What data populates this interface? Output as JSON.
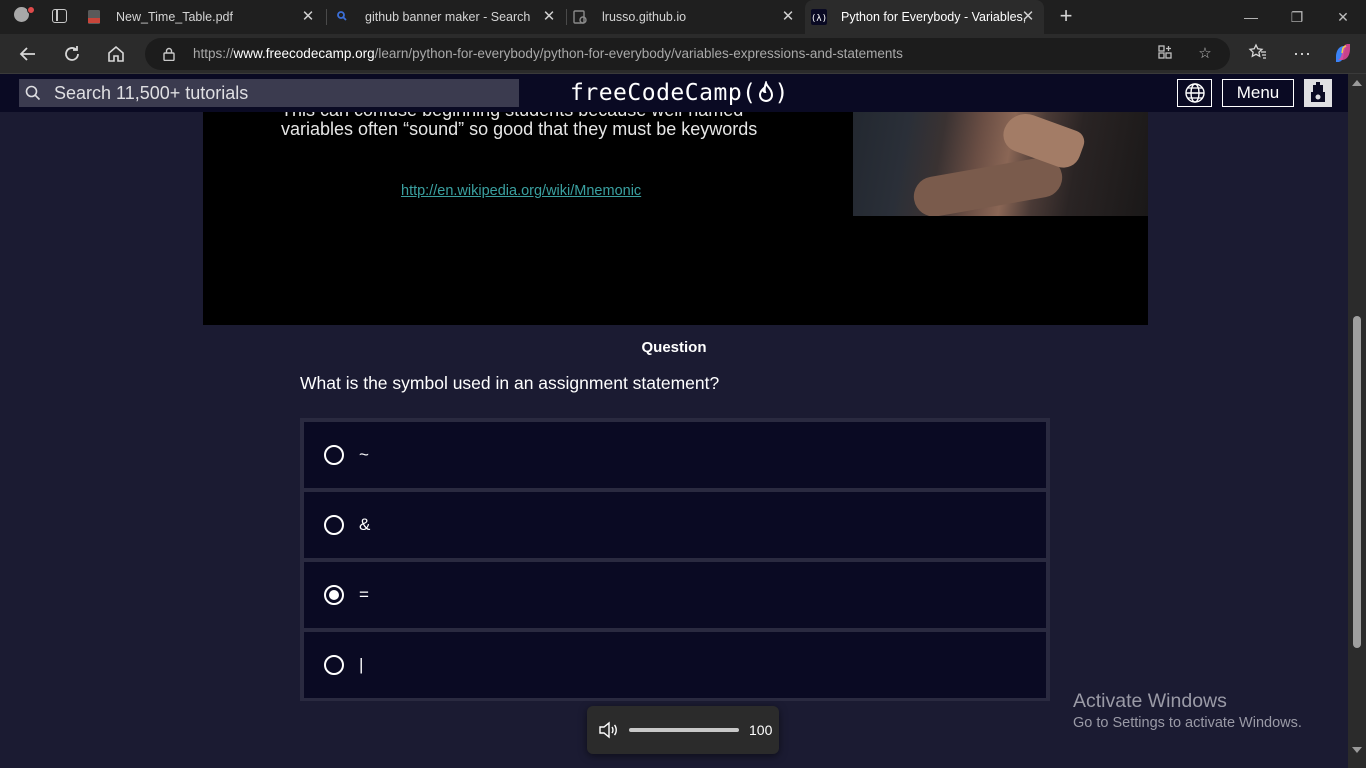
{
  "browser": {
    "tabs": [
      {
        "title": "New_Time_Table.pdf",
        "favicon": "pdf-icon",
        "active": false
      },
      {
        "title": "github banner maker - Search",
        "favicon": "bing-search-icon",
        "active": false
      },
      {
        "title": "lrusso.github.io",
        "favicon": "link-page-icon",
        "active": false
      },
      {
        "title": "Python for Everybody - Variables,",
        "favicon": "freecodecamp-icon",
        "active": true
      }
    ],
    "new_tab": "+",
    "window_controls": {
      "minimize": "—",
      "restore": "❐",
      "close": "✕"
    },
    "url": {
      "prefix": "https://",
      "domain": "www.freecodecamp.org",
      "path": "/learn/python-for-everybody/python-for-everybody/variables-expressions-and-statements"
    }
  },
  "site": {
    "search_placeholder": "Search 11,500+ tutorials",
    "logo": "freeCodeCamp(🔥)",
    "logo_text": "freeCodeCamp(",
    "logo_end": ")",
    "menu_label": "Menu"
  },
  "video": {
    "line1": "This can confuse beginning students because well-named",
    "line2": "variables often “sound” so good that they must be keywords",
    "link": "http://en.wikipedia.org/wiki/Mnemonic"
  },
  "question": {
    "heading": "Question",
    "text": "What is the symbol used in an assignment statement?",
    "answers": [
      {
        "label": "~",
        "selected": false
      },
      {
        "label": "&",
        "selected": false
      },
      {
        "label": "=",
        "selected": true
      },
      {
        "label": "|",
        "selected": false
      }
    ]
  },
  "volume": {
    "level": 100,
    "label": "100"
  },
  "watermark": {
    "title": "Activate Windows",
    "subtitle": "Go to Settings to activate Windows."
  },
  "colors": {
    "site_bg": "#1b1b32",
    "nav_bg": "#0a0a23",
    "answer_bg": "#0a0a23",
    "link": "#3aa0a0"
  }
}
